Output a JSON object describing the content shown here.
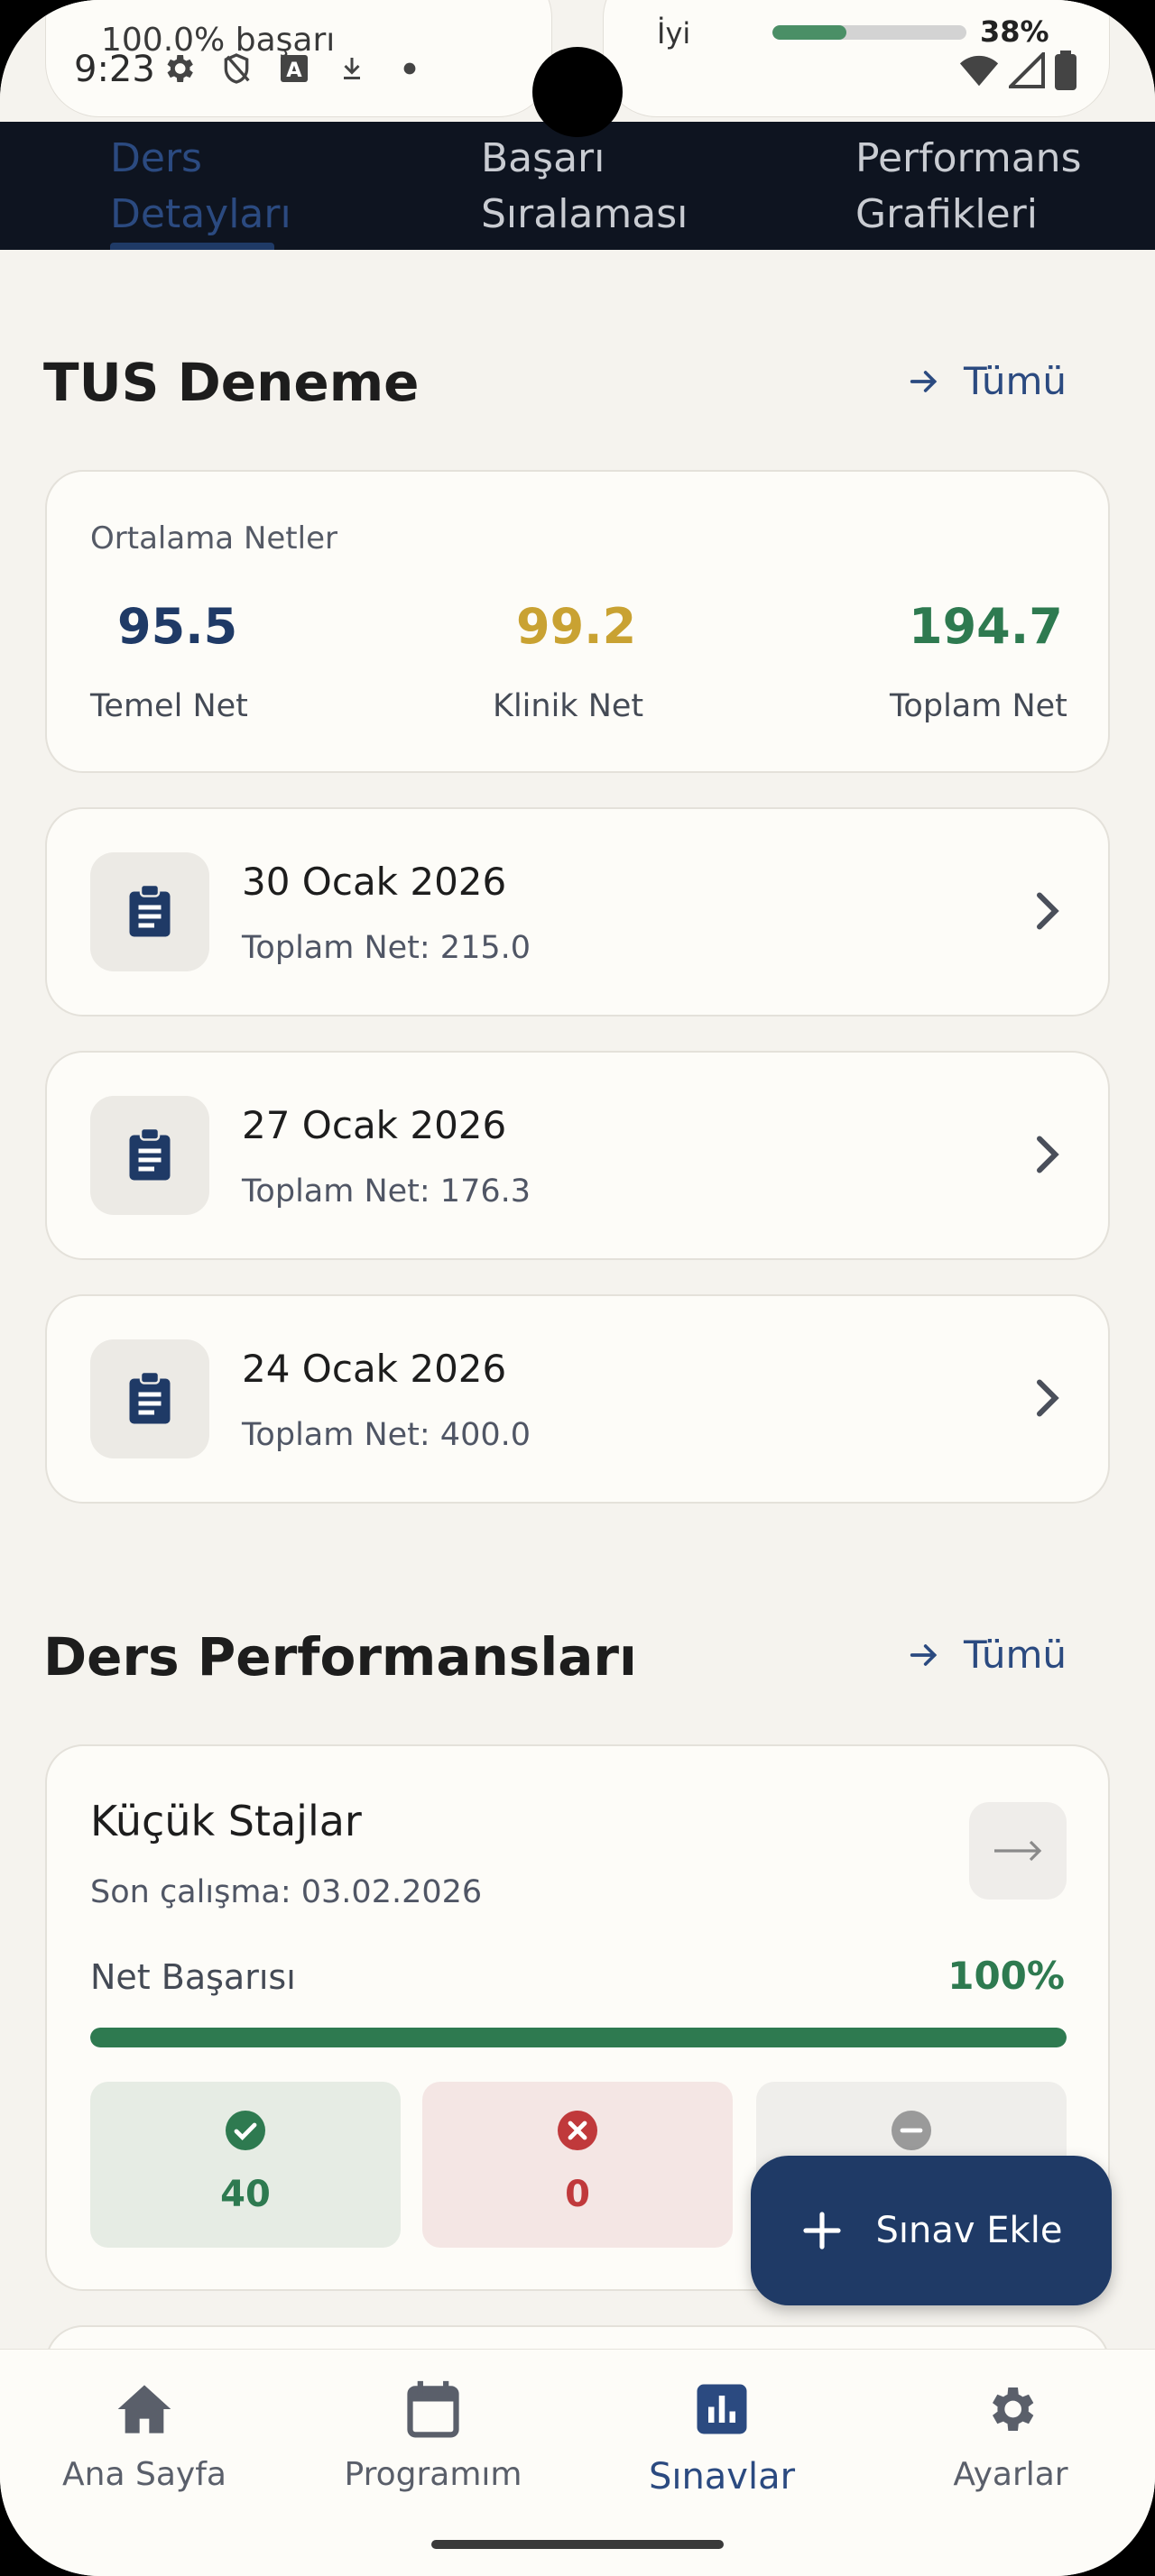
{
  "status_bar": {
    "success_text": "100.0% başarı",
    "time": "9:23",
    "signal_label": "İyi",
    "progress_fraction": 0.38,
    "battery": "38%"
  },
  "tabs": [
    {
      "label": "Ders\nDetayları",
      "active": true
    },
    {
      "label": "Başarı\nSıralaması",
      "active": false
    },
    {
      "label": "Performans\nGrafikleri",
      "active": false
    }
  ],
  "tus_section": {
    "title": "TUS Deneme",
    "see_all": "Tümü",
    "averages_title": "Ortalama Netler",
    "averages": [
      {
        "value": "95.5",
        "label": "Temel Net",
        "color": "#1f3a66"
      },
      {
        "value": "99.2",
        "label": "Klinik Net",
        "color": "#c9a232"
      },
      {
        "value": "194.7",
        "label": "Toplam Net",
        "color": "#2e7a50"
      }
    ],
    "exams": [
      {
        "date": "30 Ocak 2026",
        "net": "Toplam Net: 215.0"
      },
      {
        "date": "27 Ocak 2026",
        "net": "Toplam Net: 176.3"
      },
      {
        "date": "24 Ocak 2026",
        "net": "Toplam Net: 400.0"
      }
    ]
  },
  "perf_section": {
    "title": "Ders Performansları",
    "see_all": "Tümü",
    "card": {
      "title": "Küçük Stajlar",
      "last_study": "Son çalışma: 03.02.2026",
      "net_label": "Net Başarısı",
      "net_percent": "100%",
      "net_fraction": 1.0,
      "correct": "40",
      "wrong": "0",
      "empty": ""
    }
  },
  "fab": {
    "label": "Sınav Ekle"
  },
  "bottom_nav": [
    {
      "label": "Ana Sayfa",
      "icon": "home-icon",
      "active": false
    },
    {
      "label": "Programım",
      "icon": "calendar-icon",
      "active": false
    },
    {
      "label": "Sınavlar",
      "icon": "chart-icon",
      "active": true
    },
    {
      "label": "Ayarlar",
      "icon": "gear-icon",
      "active": false
    }
  ],
  "colors": {
    "primary": "#1f3a66",
    "success": "#2e7a50",
    "danger": "#c0393b",
    "gold": "#c9a232"
  }
}
